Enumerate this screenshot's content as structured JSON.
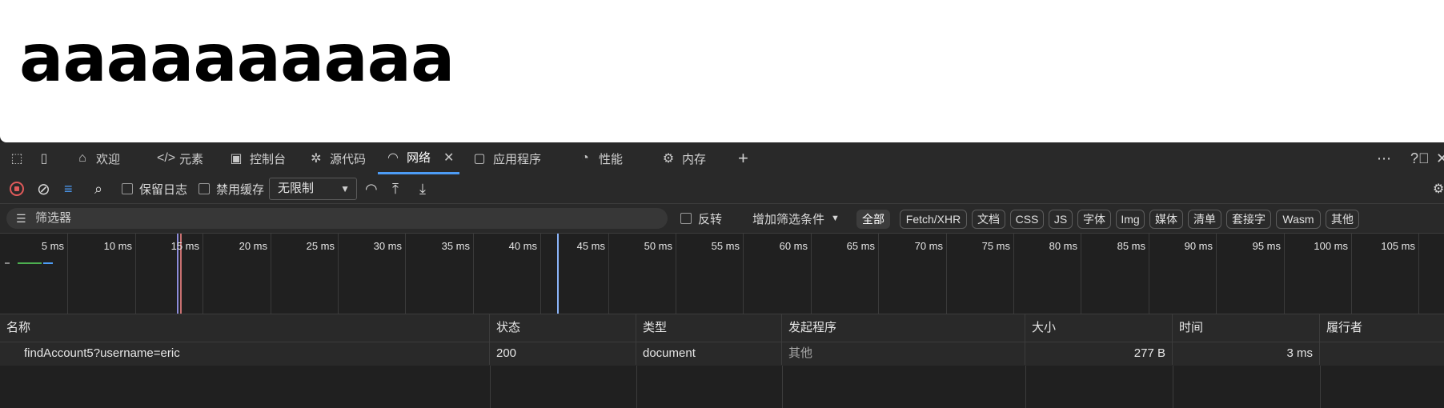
{
  "page": {
    "heading": "aaaaaaaaaa"
  },
  "devtools": {
    "tabs": [
      {
        "label": "欢迎",
        "icon": "home-icon"
      },
      {
        "label": "元素",
        "icon": "code-icon"
      },
      {
        "label": "控制台",
        "icon": "terminal-icon"
      },
      {
        "label": "源代码",
        "icon": "bug-icon"
      },
      {
        "label": "网络",
        "icon": "wifi-icon",
        "active": true
      },
      {
        "label": "应用程序",
        "icon": "app-window-icon"
      },
      {
        "label": "性能",
        "icon": "gauge-icon"
      },
      {
        "label": "内存",
        "icon": "chip-icon"
      }
    ],
    "toolbar": {
      "preserve_log": "保留日志",
      "disable_cache": "禁用缓存",
      "throttle": "无限制"
    },
    "filter": {
      "placeholder": "筛选器",
      "invert": "反转",
      "more_filters": "增加筛选条件",
      "types": [
        "全部",
        "Fetch/XHR",
        "文档",
        "CSS",
        "JS",
        "字体",
        "Img",
        "媒体",
        "清单",
        "套接字",
        "Wasm",
        "其他"
      ]
    },
    "timeline": {
      "ticks": [
        "5 ms",
        "10 ms",
        "15 ms",
        "20 ms",
        "25 ms",
        "30 ms",
        "35 ms",
        "40 ms",
        "45 ms",
        "50 ms",
        "55 ms",
        "60 ms",
        "65 ms",
        "70 ms",
        "75 ms",
        "80 ms",
        "85 ms",
        "90 ms",
        "95 ms",
        "100 ms",
        "105 ms"
      ]
    },
    "table": {
      "columns": [
        "名称",
        "状态",
        "类型",
        "发起程序",
        "大小",
        "时间",
        "履行者"
      ],
      "rows": [
        {
          "name": "findAccount5?username=eric",
          "status": "200",
          "type": "document",
          "initiator": "其他",
          "size": "277 B",
          "time": "3 ms",
          "fulfilled_by": ""
        }
      ]
    },
    "colors": {
      "accent": "#4d9cf5",
      "record": "#e05a5a",
      "background": "#202020"
    }
  }
}
